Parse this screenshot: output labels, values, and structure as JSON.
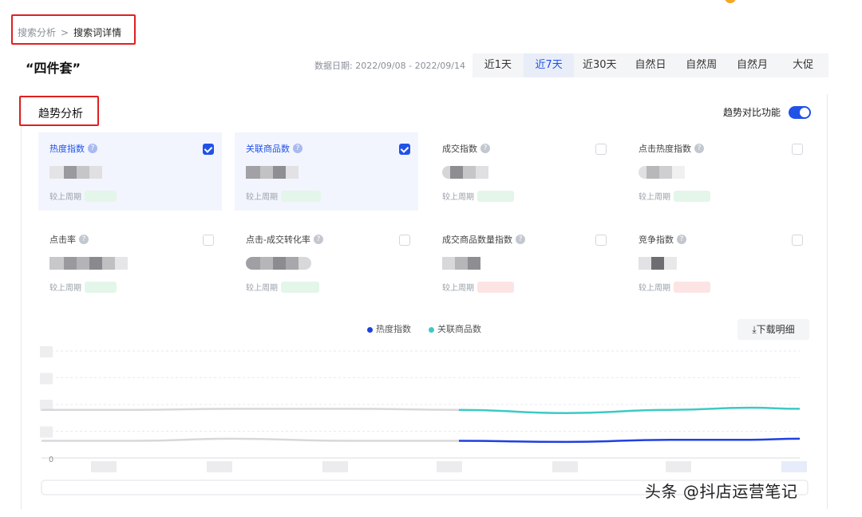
{
  "breadcrumb": {
    "parent": "搜索分析",
    "separator": ">",
    "current": "搜索词详情"
  },
  "keyword_title": "“四件套”",
  "date_range": "数据日期: 2022/09/08 - 2022/09/14",
  "tabs": [
    {
      "label": "近1天",
      "active": false
    },
    {
      "label": "近7天",
      "active": true
    },
    {
      "label": "近30天",
      "active": false
    },
    {
      "label": "自然日",
      "active": false
    },
    {
      "label": "自然周",
      "active": false
    },
    {
      "label": "自然月",
      "active": false
    },
    {
      "label": "大促",
      "active": false
    }
  ],
  "section_title": "趋势分析",
  "compare_toggle": {
    "label": "趋势对比功能",
    "on": true
  },
  "metrics": [
    {
      "name": "热度指数",
      "checked": true,
      "compare_label": "较上周期",
      "trend": "green"
    },
    {
      "name": "关联商品数",
      "checked": true,
      "compare_label": "较上周期",
      "trend": "green"
    },
    {
      "name": "成交指数",
      "checked": false,
      "compare_label": "较上周期",
      "trend": "green"
    },
    {
      "name": "点击热度指数",
      "checked": false,
      "compare_label": "较上周期",
      "trend": "green"
    },
    {
      "name": "点击率",
      "checked": false,
      "compare_label": "较上周期",
      "trend": "green"
    },
    {
      "name": "点击-成交转化率",
      "checked": false,
      "compare_label": "较上周期",
      "trend": "green"
    },
    {
      "name": "成交商品数量指数",
      "checked": false,
      "compare_label": "较上周期",
      "trend": "red"
    },
    {
      "name": "竞争指数",
      "checked": false,
      "compare_label": "较上周期",
      "trend": "red"
    }
  ],
  "download_button": "下载明细",
  "colors": {
    "accent": "#2052e8",
    "series1": "#1e40e0",
    "series2": "#3ec9c4",
    "red_box": "#e02020"
  },
  "chart_data": {
    "type": "line",
    "legend": [
      "热度指数",
      "关联商品数"
    ],
    "y_zero_label": "0",
    "series": [
      {
        "name": "关联商品数",
        "period": "previous",
        "values": [
          0.45,
          0.45,
          0.46,
          0.46,
          0.45
        ]
      },
      {
        "name": "关联商品数",
        "period": "current",
        "values": [
          0.45,
          0.42,
          0.45,
          0.47,
          0.46
        ]
      },
      {
        "name": "热度指数",
        "period": "previous",
        "values": [
          0.16,
          0.16,
          0.18,
          0.16,
          0.16
        ]
      },
      {
        "name": "热度指数",
        "period": "current",
        "values": [
          0.16,
          0.15,
          0.17,
          0.17,
          0.18
        ]
      }
    ]
  },
  "watermark": "头条 @抖店运营笔记"
}
